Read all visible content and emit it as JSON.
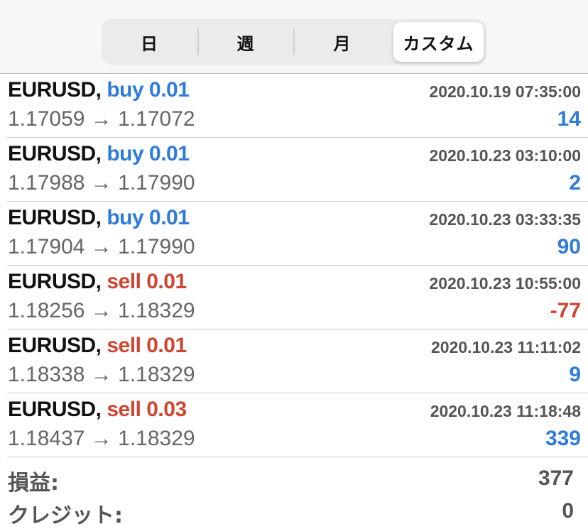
{
  "period_tabs": [
    {
      "label": "日",
      "selected": false
    },
    {
      "label": "週",
      "selected": false
    },
    {
      "label": "月",
      "selected": false
    },
    {
      "label": "カスタム",
      "selected": true
    }
  ],
  "trades": [
    {
      "symbol": "EURUSD,",
      "action": "buy 0.01",
      "side": "buy",
      "time": "2020.10.19 07:35:00",
      "open": "1.17059",
      "close": "1.17072",
      "profit": "14"
    },
    {
      "symbol": "EURUSD,",
      "action": "buy 0.01",
      "side": "buy",
      "time": "2020.10.23 03:10:00",
      "open": "1.17988",
      "close": "1.17990",
      "profit": "2"
    },
    {
      "symbol": "EURUSD,",
      "action": "buy 0.01",
      "side": "buy",
      "time": "2020.10.23 03:33:35",
      "open": "1.17904",
      "close": "1.17990",
      "profit": "90"
    },
    {
      "symbol": "EURUSD,",
      "action": "sell 0.01",
      "side": "sell",
      "time": "2020.10.23 10:55:00",
      "open": "1.18256",
      "close": "1.18329",
      "profit": "-77"
    },
    {
      "symbol": "EURUSD,",
      "action": "sell 0.01",
      "side": "sell",
      "time": "2020.10.23 11:11:02",
      "open": "1.18338",
      "close": "1.18329",
      "profit": "9"
    },
    {
      "symbol": "EURUSD,",
      "action": "sell 0.03",
      "side": "sell",
      "time": "2020.10.23 11:18:48",
      "open": "1.18437",
      "close": "1.18329",
      "profit": "339"
    }
  ],
  "arrow": "→",
  "summary": {
    "pl_label": "損益:",
    "pl_value": "377",
    "credit_label": "クレジット:",
    "credit_value": "0"
  },
  "colors": {
    "buy": "#2f7bdc",
    "sell": "#d04532",
    "positive": "#2f7bdc",
    "negative": "#d04532"
  }
}
